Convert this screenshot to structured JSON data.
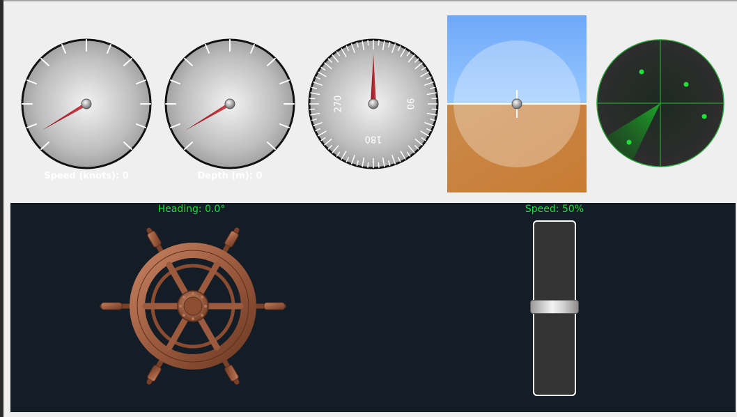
{
  "gauges": {
    "speed": {
      "label": "Speed (knots): 0",
      "value": 0
    },
    "depth": {
      "label": "Depth (m): 0",
      "value": 0
    },
    "compass": {
      "heading_deg": 0,
      "cardinals": {
        "east": "90",
        "south": "180",
        "west": "270"
      }
    }
  },
  "attitude": {
    "pitch_deg": 0,
    "roll_deg": 0
  },
  "radar": {
    "contacts": 4,
    "color": "#22e03a"
  },
  "controls": {
    "heading_label": "Heading: 0.0°",
    "speed_label": "Speed: 50%",
    "speed_percent": 50
  },
  "colors": {
    "panel_bg": "#141c26",
    "accent_green": "#19e13a",
    "needle_red": "#b5212a",
    "sky": "#8ec3ff",
    "ground": "#c98640"
  },
  "icons": {
    "wheel": "ship-wheel-icon"
  }
}
